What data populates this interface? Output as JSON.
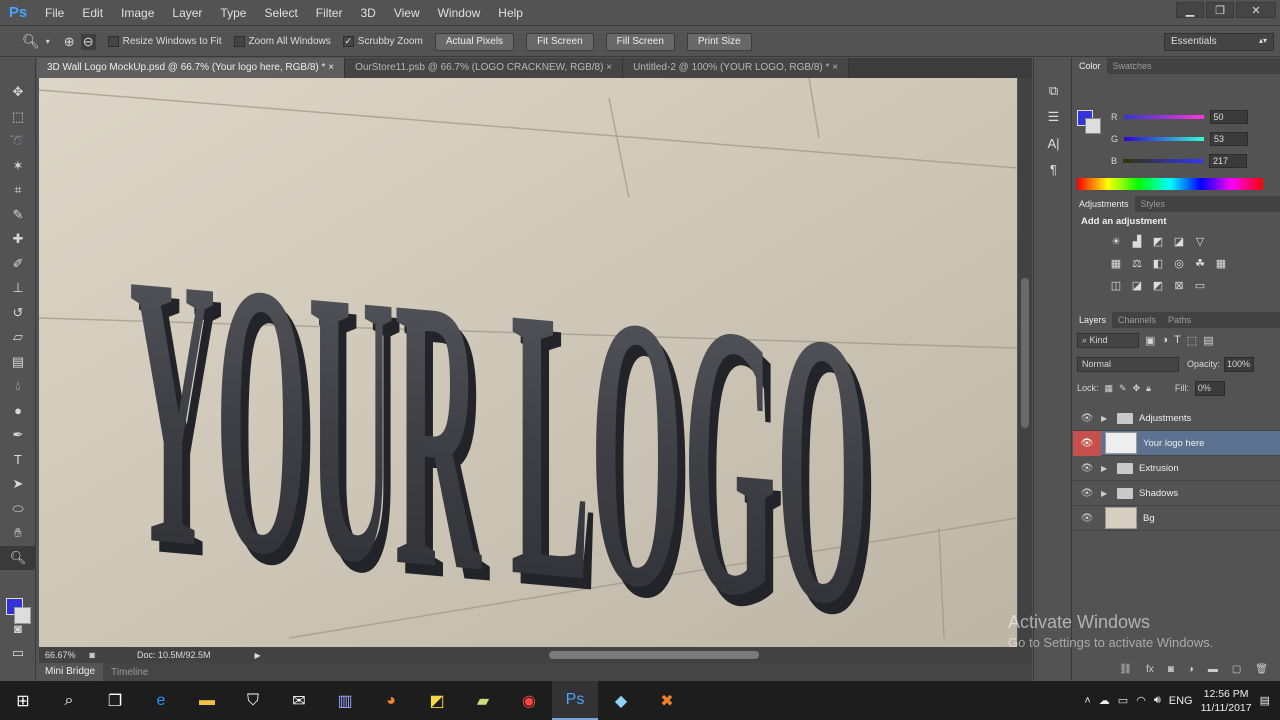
{
  "app": {
    "logo": "Ps"
  },
  "menu": [
    "File",
    "Edit",
    "Image",
    "Layer",
    "Type",
    "Select",
    "Filter",
    "3D",
    "View",
    "Window",
    "Help"
  ],
  "window_controls": {
    "minimize": "▁",
    "restore": "❐",
    "close": "✕"
  },
  "options_bar": {
    "resize_windows_label": "Resize Windows to Fit",
    "zoom_all_label": "Zoom All Windows",
    "scrubby_zoom_label": "Scrubby Zoom",
    "scrubby_checked": true,
    "buttons": [
      "Actual Pixels",
      "Fit Screen",
      "Fill Screen",
      "Print Size"
    ],
    "workspace": "Essentials"
  },
  "tabs": [
    {
      "label": "3D Wall Logo MockUp.psd @ 66.7% (Your logo here, RGB/8) *",
      "active": true
    },
    {
      "label": "OurStore11.psb @ 66.7% (LOGO CRACKNEW, RGB/8)",
      "active": false
    },
    {
      "label": "Untitled-2 @ 100% (YOUR LOGO, RGB/8) *",
      "active": false
    }
  ],
  "canvas_text": "YOUR LOGO",
  "status": {
    "zoom": "66.67%",
    "doc": "Doc: 10.5M/92.5M"
  },
  "bottom_tabs": [
    "Mini Bridge",
    "Timeline"
  ],
  "color_panel": {
    "tabs": [
      "Color",
      "Swatches"
    ],
    "r_label": "R",
    "g_label": "G",
    "b_label": "B",
    "r": "50",
    "g": "53",
    "b": "217",
    "fg_color": "#3235d9"
  },
  "adjustments_panel": {
    "tabs": [
      "Adjustments",
      "Styles"
    ],
    "title": "Add an adjustment"
  },
  "layers_panel": {
    "tabs": [
      "Layers",
      "Channels",
      "Paths"
    ],
    "kind": "Kind",
    "blend_mode": "Normal",
    "opacity_label": "Opacity:",
    "opacity": "100%",
    "lock_label": "Lock:",
    "fill_label": "Fill:",
    "fill": "0%",
    "layers": [
      {
        "name": "Adjustments",
        "type": "group",
        "selected": false
      },
      {
        "name": "Your logo here",
        "type": "smart",
        "selected": true
      },
      {
        "name": "Extrusion",
        "type": "group",
        "selected": false
      },
      {
        "name": "Shadows",
        "type": "group",
        "selected": false
      },
      {
        "name": "Bg",
        "type": "smart",
        "selected": false
      }
    ]
  },
  "watermark": {
    "line1": "Activate Windows",
    "line2": "Go to Settings to activate Windows."
  },
  "taskbar": {
    "lang": "ENG",
    "time": "12:56 PM",
    "date": "11/11/2017"
  }
}
